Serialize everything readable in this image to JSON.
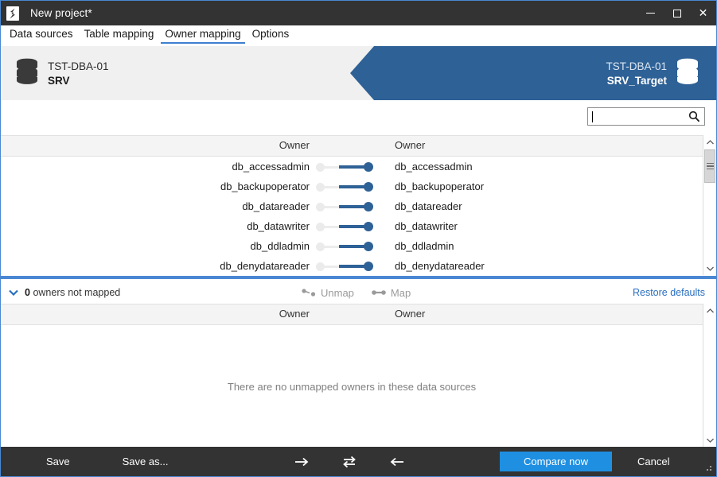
{
  "window": {
    "title": "New project*",
    "logo_icon": "apexsql-logo-icon",
    "minimize_icon": "minimize-icon",
    "maximize_icon": "maximize-icon",
    "close_icon": "close-icon"
  },
  "tabs": [
    {
      "label": "Data sources",
      "active": false
    },
    {
      "label": "Table mapping",
      "active": false
    },
    {
      "label": "Owner mapping",
      "active": true
    },
    {
      "label": "Options",
      "active": false
    }
  ],
  "endpoints": {
    "source": {
      "server": "TST-DBA-01",
      "database": "SRV",
      "icon": "database-icon"
    },
    "target": {
      "server": "TST-DBA-01",
      "database": "SRV_Target",
      "icon": "database-icon"
    }
  },
  "search": {
    "value": "",
    "placeholder": "",
    "icon": "search-icon"
  },
  "mapped_panel": {
    "columns": [
      "Owner",
      "Owner"
    ],
    "rows": [
      {
        "left": "db_accessadmin",
        "right": "db_accessadmin"
      },
      {
        "left": "db_backupoperator",
        "right": "db_backupoperator"
      },
      {
        "left": "db_datareader",
        "right": "db_datareader"
      },
      {
        "left": "db_datawriter",
        "right": "db_datawriter"
      },
      {
        "left": "db_ddladmin",
        "right": "db_ddladmin"
      },
      {
        "left": "db_denydatareader",
        "right": "db_denydatareader"
      }
    ]
  },
  "middle_bar": {
    "toggle_icon": "chevron-down-icon",
    "count": "0",
    "count_label": "owners not mapped",
    "unmap_label": "Unmap",
    "unmap_icon": "unlink-icon",
    "map_label": "Map",
    "map_icon": "link-icon",
    "restore_defaults_label": "Restore defaults"
  },
  "unmapped_panel": {
    "columns": [
      "Owner",
      "Owner"
    ],
    "empty_message": "There are no unmapped owners in these data sources"
  },
  "bottom_bar": {
    "save_label": "Save",
    "save_as_label": "Save as...",
    "arrow_right_icon": "arrow-right-icon",
    "swap_icon": "swap-arrows-icon",
    "arrow_left_icon": "arrow-left-icon",
    "compare_label": "Compare now",
    "cancel_label": "Cancel",
    "resize_grip_icon": "resize-grip-icon"
  },
  "colors": {
    "accent_blue": "#3f7fd0",
    "target_blue": "#2e6196",
    "compare_blue": "#1e8fe1",
    "chrome_dark": "#333333",
    "link_blue": "#2a6fc0"
  }
}
